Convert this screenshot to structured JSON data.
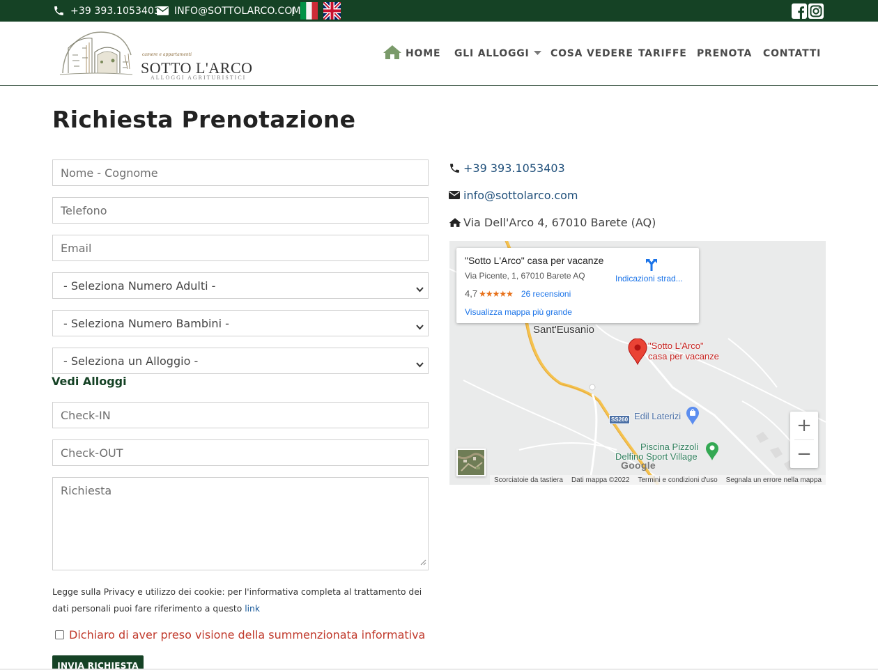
{
  "topbar": {
    "phone": "+39 393.1053403",
    "email": "INFO@SOTTOLARCO.COM",
    "separator": "|",
    "languages": [
      "Italiano",
      "English"
    ],
    "social": [
      "facebook-icon",
      "instagram-icon"
    ]
  },
  "logo": {
    "tagline": "camere e appartamenti",
    "name": "SOTTO L'ARCO",
    "subtitle": "ALLOGGI AGRITURISTICI"
  },
  "nav": {
    "home": "HOME",
    "alloggi": "GLI ALLOGGI",
    "cosa_vedere": "COSA VEDERE",
    "tariffe": "TARIFFE",
    "prenota": "PRENOTA",
    "contatti": "CONTATTI"
  },
  "page": {
    "title": "Richiesta Prenotazione"
  },
  "form": {
    "nome_placeholder": "Nome - Cognome",
    "telefono_placeholder": "Telefono",
    "email_placeholder": "Email",
    "adulti_selected": "- Seleziona Numero Adulti -",
    "bambini_selected": "- Seleziona Numero Bambini -",
    "alloggio_selected": "- Seleziona un Alloggio -",
    "vedi_alloggi": "Vedi Alloggi",
    "checkin_placeholder": "Check-IN",
    "checkout_placeholder": "Check-OUT",
    "richiesta_placeholder": "Richiesta",
    "privacy_text": "Legge sulla Privacy e utilizzo dei cookie: per l'informativa completa al trattamento dei dati personali puoi fare riferimento a questo ",
    "privacy_link": "link",
    "consent_label": "Dichiaro di aver preso visione della summenzionata informativa",
    "submit_label": "INVIA RICHIESTA"
  },
  "contact": {
    "phone": "+39 393.1053403",
    "email": "info@sottolarco.com",
    "address": "Via Dell'Arco 4, 67010 Barete (AQ)"
  },
  "map": {
    "place_title": "\"Sotto L'Arco\" casa per vacanze",
    "place_address": "Via Picente, 1, 67010 Barete AQ",
    "rating": "4,7",
    "stars": "★★★★★",
    "reviews": "26 recensioni",
    "bigger_map": "Visualizza mappa più grande",
    "directions": "Indicazioni strad...",
    "labels": {
      "town": "Sant'Eusanio",
      "marker_line1": "\"Sotto L'Arco\"",
      "marker_line2": "casa per vacanze",
      "edil": "Edil Laterizi",
      "piscina": "Piscina Pizzoli",
      "delfino": "Delfino Sport Village",
      "road": "SS260",
      "google": "Google"
    },
    "zoom_in": "+",
    "zoom_out": "−",
    "attribution": [
      "Scorciatoie da tastiera",
      "Dati mappa ©2022",
      "Termini e condizioni d'uso",
      "Segnala un errore nella mappa"
    ]
  },
  "colors": {
    "brand_green": "#154225",
    "error_red": "#c0392b",
    "link_blue": "#1a73e8"
  }
}
